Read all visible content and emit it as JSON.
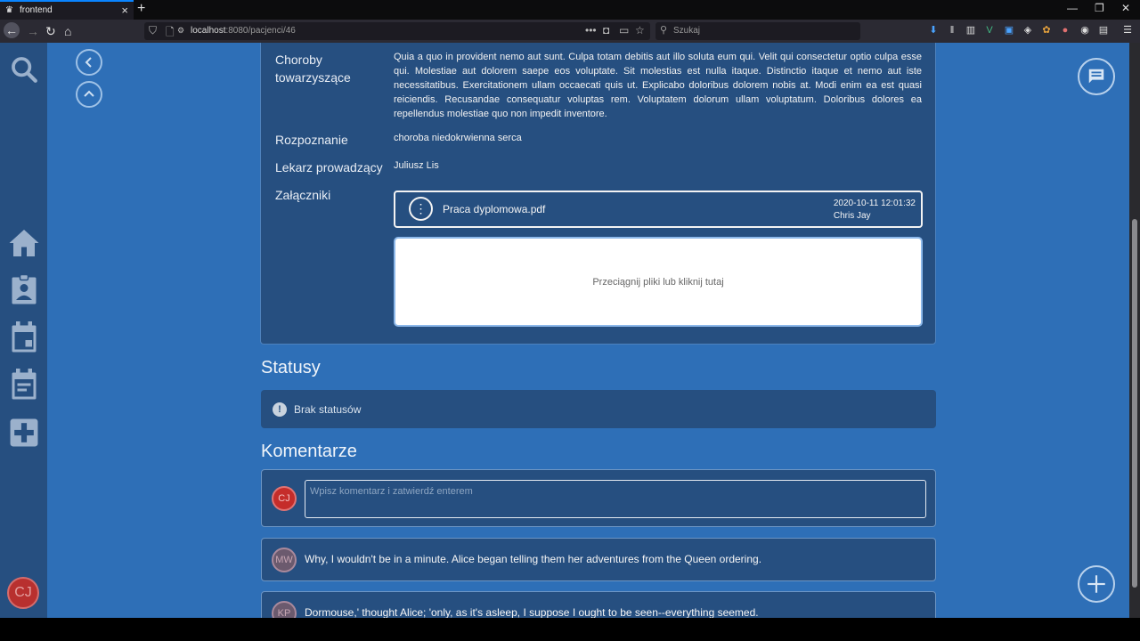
{
  "browser": {
    "tab_title": "frontend",
    "url_host": "localhost",
    "url_path": ":8080/pacjenci/46",
    "search_placeholder": "Szukaj"
  },
  "patient": {
    "fields": [
      {
        "label_line1": "Choroby",
        "label_line2": "towarzyszące",
        "value": "Quia a quo in provident nemo aut sunt. Culpa totam debitis aut illo soluta eum qui. Velit qui consectetur optio culpa esse qui. Molestiae aut dolorem saepe eos voluptate. Sit molestias est nulla itaque. Distinctio itaque et nemo aut iste necessitatibus. Exercitationem ullam occaecati quis ut. Explicabo doloribus dolorem nobis at. Modi enim ea est quasi reiciendis. Recusandae consequatur voluptas rem. Voluptatem dolorum ullam voluptatum. Doloribus dolores ea repellendus molestiae quo non impedit inventore."
      },
      {
        "label": "Rozpoznanie",
        "value": "choroba niedokrwienna serca"
      },
      {
        "label": "Lekarz prowadzący",
        "value": "Juliusz Lis"
      },
      {
        "label": "Załączniki"
      }
    ],
    "attachment": {
      "filename": "Praca dyplomowa.pdf",
      "date": "2020-10-11 12:01:32",
      "author": "Chris Jay"
    },
    "dropzone_text": "Przeciągnij pliki lub kliknij tutaj"
  },
  "statuses": {
    "heading": "Statusy",
    "empty_text": "Brak statusów"
  },
  "comments": {
    "heading": "Komentarze",
    "input_placeholder": "Wpisz komentarz i zatwierdź enterem",
    "current_user_initials": "CJ",
    "items": [
      {
        "initials": "MW",
        "text": "Why, I wouldn't be in a minute. Alice began telling them her adventures from the Queen ordering."
      },
      {
        "initials": "KP",
        "text": "Dormouse,' thought Alice; 'only, as it's asleep, I suppose I ought to be seen--everything seemed."
      }
    ]
  },
  "sidebar": {
    "user_initials": "CJ"
  }
}
